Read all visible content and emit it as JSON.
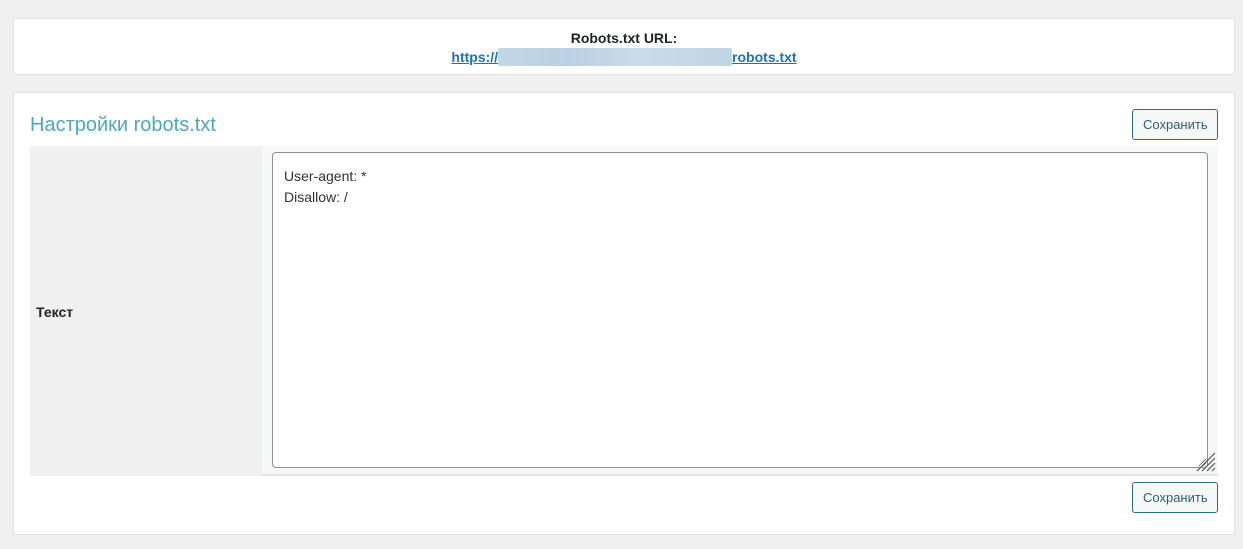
{
  "url_panel": {
    "label": "Robots.txt URL:",
    "url_prefix": "https://",
    "url_suffix": "robots.txt"
  },
  "settings": {
    "title": "Настройки robots.txt",
    "save_button_top": "Сохранить",
    "save_button_bottom": "Сохранить",
    "text_row_label": "Текст",
    "textarea_value": "User-agent: *\nDisallow: /"
  },
  "colors": {
    "title": "#4fa8b8",
    "link": "#2271b1",
    "button_border": "#2c6e80",
    "page_background": "#f0f0f1"
  },
  "icons": {
    "resize_handle": "resize-handle-icon"
  }
}
